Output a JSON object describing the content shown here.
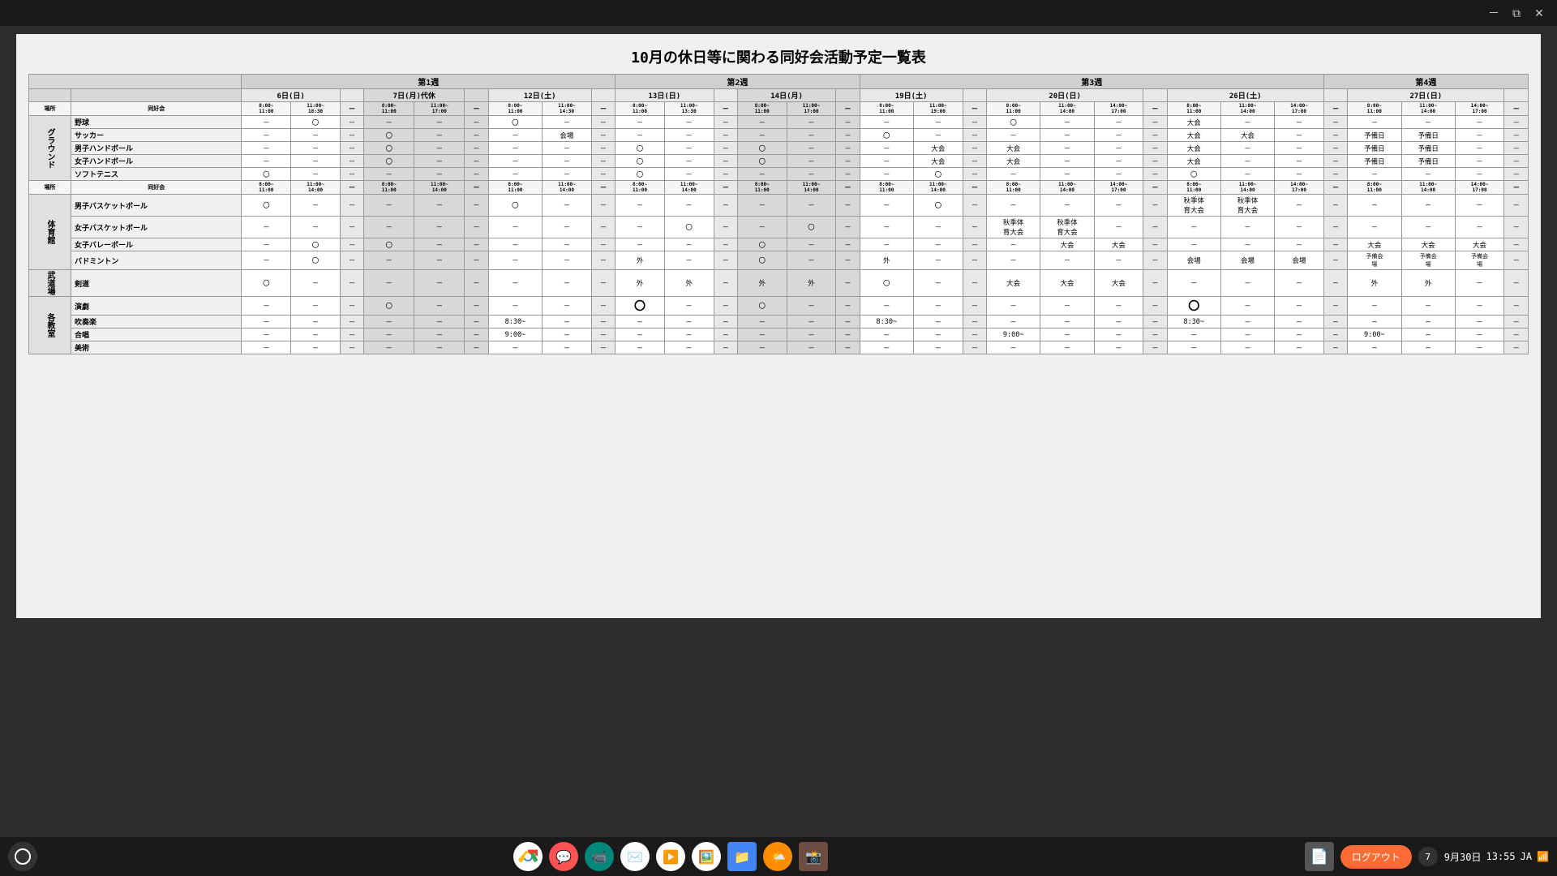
{
  "title": "10月の休日等に関わる同好会活動予定一覧表",
  "titlebar": {
    "minimize": "－",
    "maximize": "□",
    "close": "✕"
  },
  "table": {
    "weeks": [
      "第1週",
      "第2週",
      "第3週",
      "第4週"
    ],
    "dates": [
      {
        "date": "6日(日)",
        "cols": 2
      },
      {
        "date": "7日(月)代休",
        "cols": 2
      },
      {
        "date": "12日(土)",
        "cols": 2
      },
      {
        "date": "13日(日)",
        "cols": 2
      },
      {
        "date": "14日(月)",
        "cols": 2
      },
      {
        "date": "19日(土)",
        "cols": 2
      },
      {
        "date": "20日(日)",
        "cols": 3
      },
      {
        "date": "26日(土)",
        "cols": 3
      },
      {
        "date": "27日(日)",
        "cols": 3
      }
    ]
  },
  "taskbar": {
    "date": "9月30日",
    "time": "13:55",
    "lang": "JA",
    "logout": "ログアウト",
    "badge": "7"
  }
}
